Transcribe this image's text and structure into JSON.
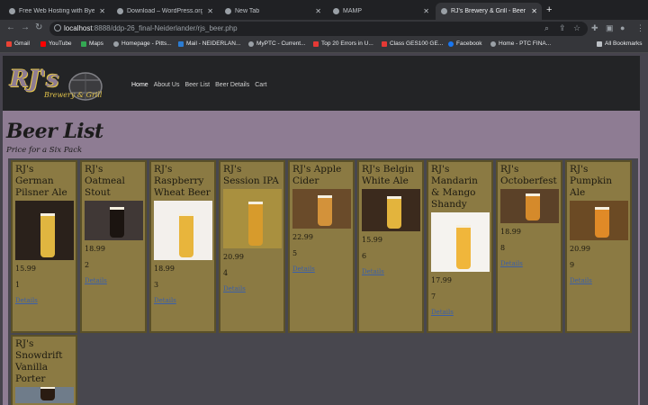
{
  "browser": {
    "tabs": [
      {
        "label": "Free Web Hosting with Byet H",
        "active": false
      },
      {
        "label": "Download – WordPress.org",
        "active": false
      },
      {
        "label": "New Tab",
        "active": false
      },
      {
        "label": "MAMP",
        "active": false
      },
      {
        "label": "RJ's Brewery & Grill - Beer Li",
        "active": true
      }
    ],
    "url_host": "localhost",
    "url_path": ":8888/ddp-26_final-Neiderlander/rjs_beer.php",
    "bookmarks": [
      {
        "label": "Gmail",
        "color": "#ea4335"
      },
      {
        "label": "YouTube",
        "color": "#ff0000"
      },
      {
        "label": "Maps",
        "color": "#34a853"
      },
      {
        "label": "Homepage - Pitts...",
        "color": "#9aa0a6"
      },
      {
        "label": "Mail - NEIDERLAN...",
        "color": "#2b7cd3"
      },
      {
        "label": "MyPTC - Current...",
        "color": "#9aa0a6"
      },
      {
        "label": "Top 20 Errors in U...",
        "color": "#e53935"
      },
      {
        "label": "Class GES100 GE...",
        "color": "#e53935"
      },
      {
        "label": "Facebook",
        "color": "#1877f2"
      },
      {
        "label": "Home - PTC FINA...",
        "color": "#9aa0a6"
      }
    ],
    "all_bookmarks": "All Bookmarks"
  },
  "site": {
    "logo_text": "RJ's",
    "logo_sub": "Brewery & Grill",
    "nav": [
      "Home",
      "About Us",
      "Beer List",
      "Beer Details",
      "Cart"
    ],
    "title": "Beer List",
    "subtitle": "Price for a Six Pack",
    "link_label": "Details",
    "beers": [
      {
        "name": "RJ's German Pilsner Ale",
        "price": "15.99",
        "qty": "1",
        "bg": "#2a211b",
        "beer": "#e0b640"
      },
      {
        "name": "RJ's Oatmeal Stout",
        "price": "18.99",
        "qty": "2",
        "bg": "#403836",
        "beer": "#1b1410"
      },
      {
        "name": "RJ's Raspberry Wheat Beer",
        "price": "18.99",
        "qty": "3",
        "bg": "#f3f0ec",
        "beer": "#e8b53c"
      },
      {
        "name": "RJ's Session IPA",
        "price": "20.99",
        "qty": "4",
        "bg": "#a9903f",
        "beer": "#d79b2c"
      },
      {
        "name": "RJ's Apple Cider",
        "price": "22.99",
        "qty": "5",
        "bg": "#6a4b2a",
        "beer": "#d3923a"
      },
      {
        "name": "RJ's Belgin White Ale",
        "price": "15.99",
        "qty": "6",
        "bg": "#3b2a1d",
        "beer": "#e3b43d"
      },
      {
        "name": "RJ's Mandarin & Mango Shandy",
        "price": "17.99",
        "qty": "7",
        "bg": "#f5f3ef",
        "beer": "#f0b63b"
      },
      {
        "name": "RJ's Octoberfest",
        "price": "18.99",
        "qty": "8",
        "bg": "#5b4128",
        "beer": "#d58a2b"
      },
      {
        "name": "RJ's Pumpkin Ale",
        "price": "20.99",
        "qty": "9",
        "bg": "#6b4a24",
        "beer": "#e08a27"
      },
      {
        "name": "RJ's Snowdrift Vanilla Porter",
        "price": "",
        "qty": "",
        "bg": "#6f7c8a",
        "beer": "#2a1c12"
      }
    ]
  }
}
